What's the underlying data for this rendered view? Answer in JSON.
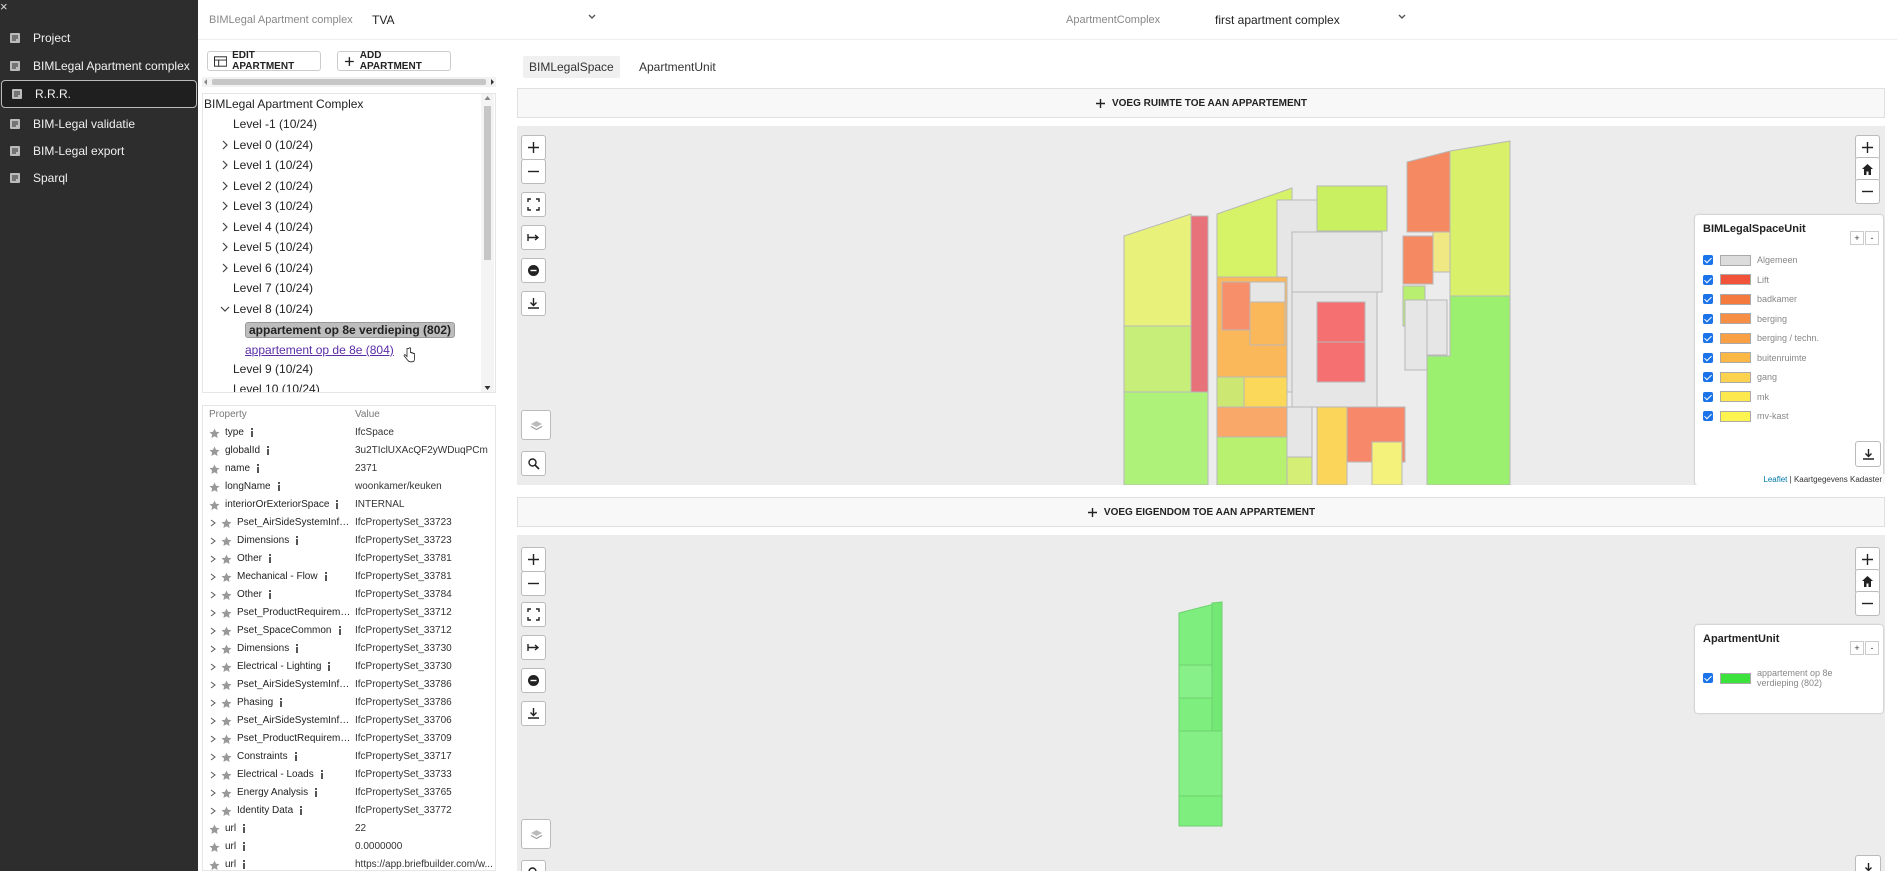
{
  "sidebar": {
    "items": [
      {
        "label": "Project",
        "icon": "dataset-icon",
        "active": false
      },
      {
        "label": "BIMLegal Apartment complex",
        "icon": "dataset-icon",
        "active": false
      },
      {
        "label": "R.R.R.",
        "icon": "dataset-icon",
        "active": true
      },
      {
        "label": "BIM-Legal validatie",
        "icon": "dataset-icon",
        "active": false
      },
      {
        "label": "BIM-Legal export",
        "icon": "dataset-icon",
        "active": false
      },
      {
        "label": "Sparql",
        "icon": "dataset-icon",
        "active": false
      }
    ]
  },
  "topbar": {
    "complex_label": "BIMLegal Apartment complex",
    "complex_value": "TVA",
    "apartment_label": "ApartmentComplex",
    "apartment_value": "first apartment complex"
  },
  "toolbar": {
    "edit_label": "EDIT APARTMENT",
    "add_label": "ADD APARTMENT"
  },
  "tree": {
    "root": "BIMLegal Apartment Complex",
    "levels": [
      {
        "label": "Level -1 (10/24)",
        "expandable": false
      },
      {
        "label": "Level 0 (10/24)",
        "expandable": true
      },
      {
        "label": "Level 1 (10/24)",
        "expandable": true
      },
      {
        "label": "Level 2 (10/24)",
        "expandable": true
      },
      {
        "label": "Level 3 (10/24)",
        "expandable": true
      },
      {
        "label": "Level 4 (10/24)",
        "expandable": true
      },
      {
        "label": "Level 5 (10/24)",
        "expandable": true
      },
      {
        "label": "Level 6 (10/24)",
        "expandable": true
      },
      {
        "label": "Level 7 (10/24)",
        "expandable": false
      },
      {
        "label": "Level 8 (10/24)",
        "expandable": true,
        "expanded": true
      }
    ],
    "selected_child": "appartement op 8e verdieping (802)",
    "link_child": "appartement op de 8e (804)",
    "after_levels": [
      "Level 9 (10/24)",
      "Level 10 (10/24)"
    ]
  },
  "properties": {
    "header_property": "Property",
    "header_value": "Value",
    "rows": [
      {
        "name": "type",
        "value": "IfcSpace",
        "expand": false
      },
      {
        "name": "globalId",
        "value": "3u2TIclUXAcQF2yWDuqPCm",
        "expand": false
      },
      {
        "name": "name",
        "value": "2371",
        "expand": false
      },
      {
        "name": "longName",
        "value": "woonkamer/keuken",
        "expand": false
      },
      {
        "name": "interiorOrExteriorSpace",
        "value": "INTERNAL",
        "expand": false
      },
      {
        "name": "Pset_AirSideSystemInfor...",
        "value": "IfcPropertySet_33723",
        "expand": true
      },
      {
        "name": "Dimensions",
        "value": "IfcPropertySet_33723",
        "expand": true
      },
      {
        "name": "Other",
        "value": "IfcPropertySet_33781",
        "expand": true
      },
      {
        "name": "Mechanical - Flow",
        "value": "IfcPropertySet_33781",
        "expand": true
      },
      {
        "name": "Other",
        "value": "IfcPropertySet_33784",
        "expand": true
      },
      {
        "name": "Pset_ProductRequireme...",
        "value": "IfcPropertySet_33712",
        "expand": true
      },
      {
        "name": "Pset_SpaceCommon",
        "value": "IfcPropertySet_33712",
        "expand": true
      },
      {
        "name": "Dimensions",
        "value": "IfcPropertySet_33730",
        "expand": true
      },
      {
        "name": "Electrical - Lighting",
        "value": "IfcPropertySet_33730",
        "expand": true
      },
      {
        "name": "Pset_AirSideSystemInfor...",
        "value": "IfcPropertySet_33786",
        "expand": true
      },
      {
        "name": "Phasing",
        "value": "IfcPropertySet_33786",
        "expand": true
      },
      {
        "name": "Pset_AirSideSystemInfor...",
        "value": "IfcPropertySet_33706",
        "expand": true
      },
      {
        "name": "Pset_ProductRequireme...",
        "value": "IfcPropertySet_33709",
        "expand": true
      },
      {
        "name": "Constraints",
        "value": "IfcPropertySet_33717",
        "expand": true
      },
      {
        "name": "Electrical - Loads",
        "value": "IfcPropertySet_33733",
        "expand": true
      },
      {
        "name": "Energy Analysis",
        "value": "IfcPropertySet_33765",
        "expand": true
      },
      {
        "name": "Identity Data",
        "value": "IfcPropertySet_33772",
        "expand": true
      },
      {
        "name": "url",
        "value": "22",
        "expand": false
      },
      {
        "name": "url",
        "value": "0.0000000",
        "expand": false
      },
      {
        "name": "url",
        "value": "https://app.briefbuilder.com/w...",
        "expand": false
      }
    ]
  },
  "tabs": [
    {
      "label": "BIMLegalSpace",
      "active": true
    },
    {
      "label": "ApartmentUnit",
      "active": false
    }
  ],
  "actions": {
    "add_space_label": "VOEG RUIMTE TOE AAN APPARTEMENT",
    "add_property_label": "VOEG EIGENDOM TOE AAN APPARTEMENT"
  },
  "legend_space": {
    "title": "BIMLegalSpaceUnit",
    "plus": "+",
    "minus": "-",
    "items": [
      {
        "label": "Algemeen",
        "color": "#dcdcdc"
      },
      {
        "label": "Lift",
        "color": "#f0533a"
      },
      {
        "label": "badkamer",
        "color": "#f57a3e"
      },
      {
        "label": "berging",
        "color": "#f78e45"
      },
      {
        "label": "berging / techn.",
        "color": "#f9a044"
      },
      {
        "label": "buitenruimte",
        "color": "#fbb845"
      },
      {
        "label": "gang",
        "color": "#fdd24e"
      },
      {
        "label": "mk",
        "color": "#fde84e"
      },
      {
        "label": "mv-kast",
        "color": "#fdf44f"
      }
    ]
  },
  "legend_unit": {
    "title": "ApartmentUnit",
    "plus": "+",
    "minus": "-",
    "items": [
      {
        "label": "appartement op 8e verdieping (802)",
        "color": "#3be23b"
      }
    ]
  },
  "attribution": {
    "leaflet": "Leaflet",
    "rest": "| Kaartgegevens Kadaster"
  }
}
